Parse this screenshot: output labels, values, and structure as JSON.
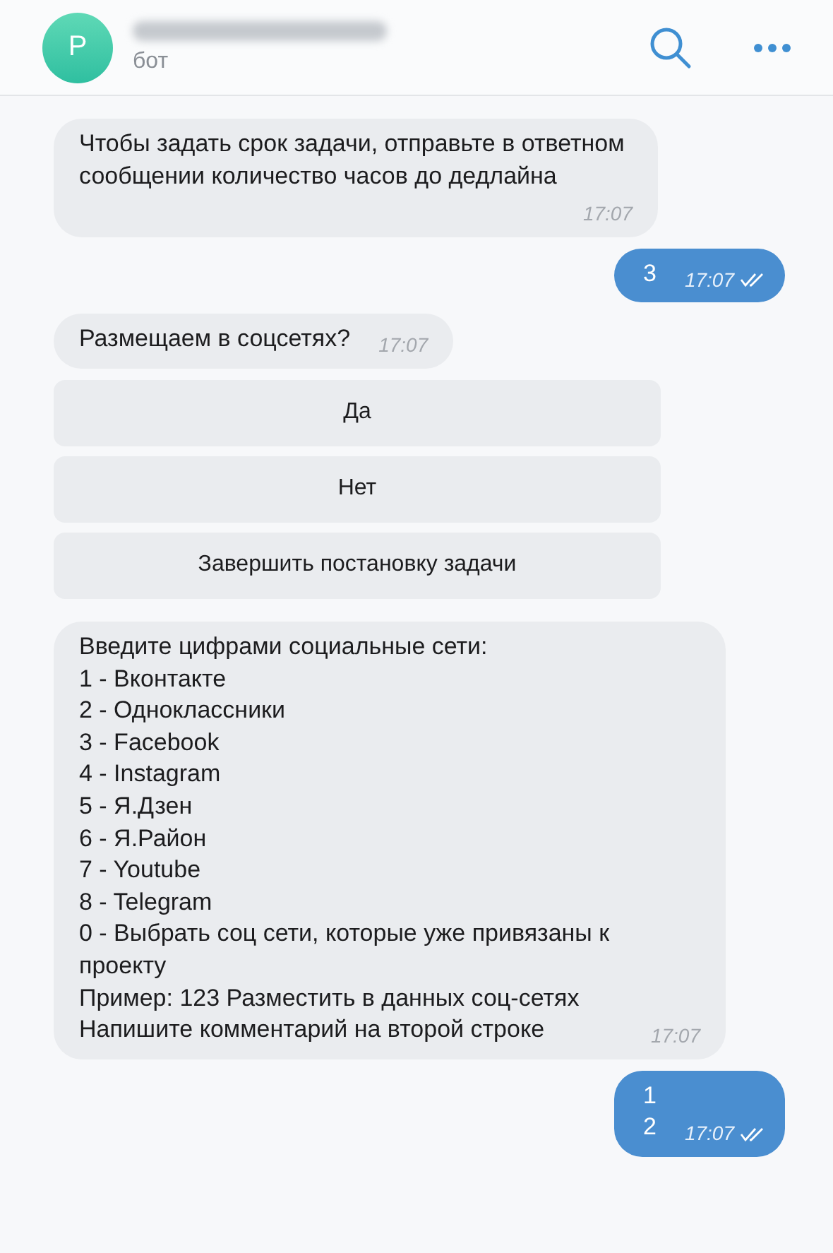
{
  "header": {
    "avatar_letter": "P",
    "subtitle": "бот"
  },
  "messages": [
    {
      "kind": "incoming",
      "lines": [
        "Чтобы задать срок задачи, отправьте в ответном сообщении количество часов до дедлайна"
      ],
      "time": "17:07"
    },
    {
      "kind": "outgoing",
      "lines": [
        "3"
      ],
      "time": "17:07",
      "read": true
    },
    {
      "kind": "incoming",
      "lines": [
        "Размещаем в соцсетях?"
      ],
      "time": "17:07"
    },
    {
      "kind": "keyboard",
      "buttons": [
        "Да",
        "Нет",
        "Завершить постановку задачи"
      ]
    },
    {
      "kind": "incoming",
      "lines": [
        "Введите цифрами социальные сети:",
        "1 - Вконтакте",
        "2 - Одноклассники",
        "3 - Facebook",
        "4 - Instagram",
        "5 - Я.Дзен",
        "6 - Я.Район",
        "7 - Youtube",
        "8 - Telegram",
        "0 - Выбрать соц сети, которые уже привязаны к проекту",
        "Пример: 123 Разместить в данных соц-сетях",
        "Напишите комментарий на второй строке"
      ],
      "time": "17:07"
    },
    {
      "kind": "outgoing",
      "lines": [
        "1",
        "2"
      ],
      "time": "17:07",
      "read": true
    }
  ]
}
